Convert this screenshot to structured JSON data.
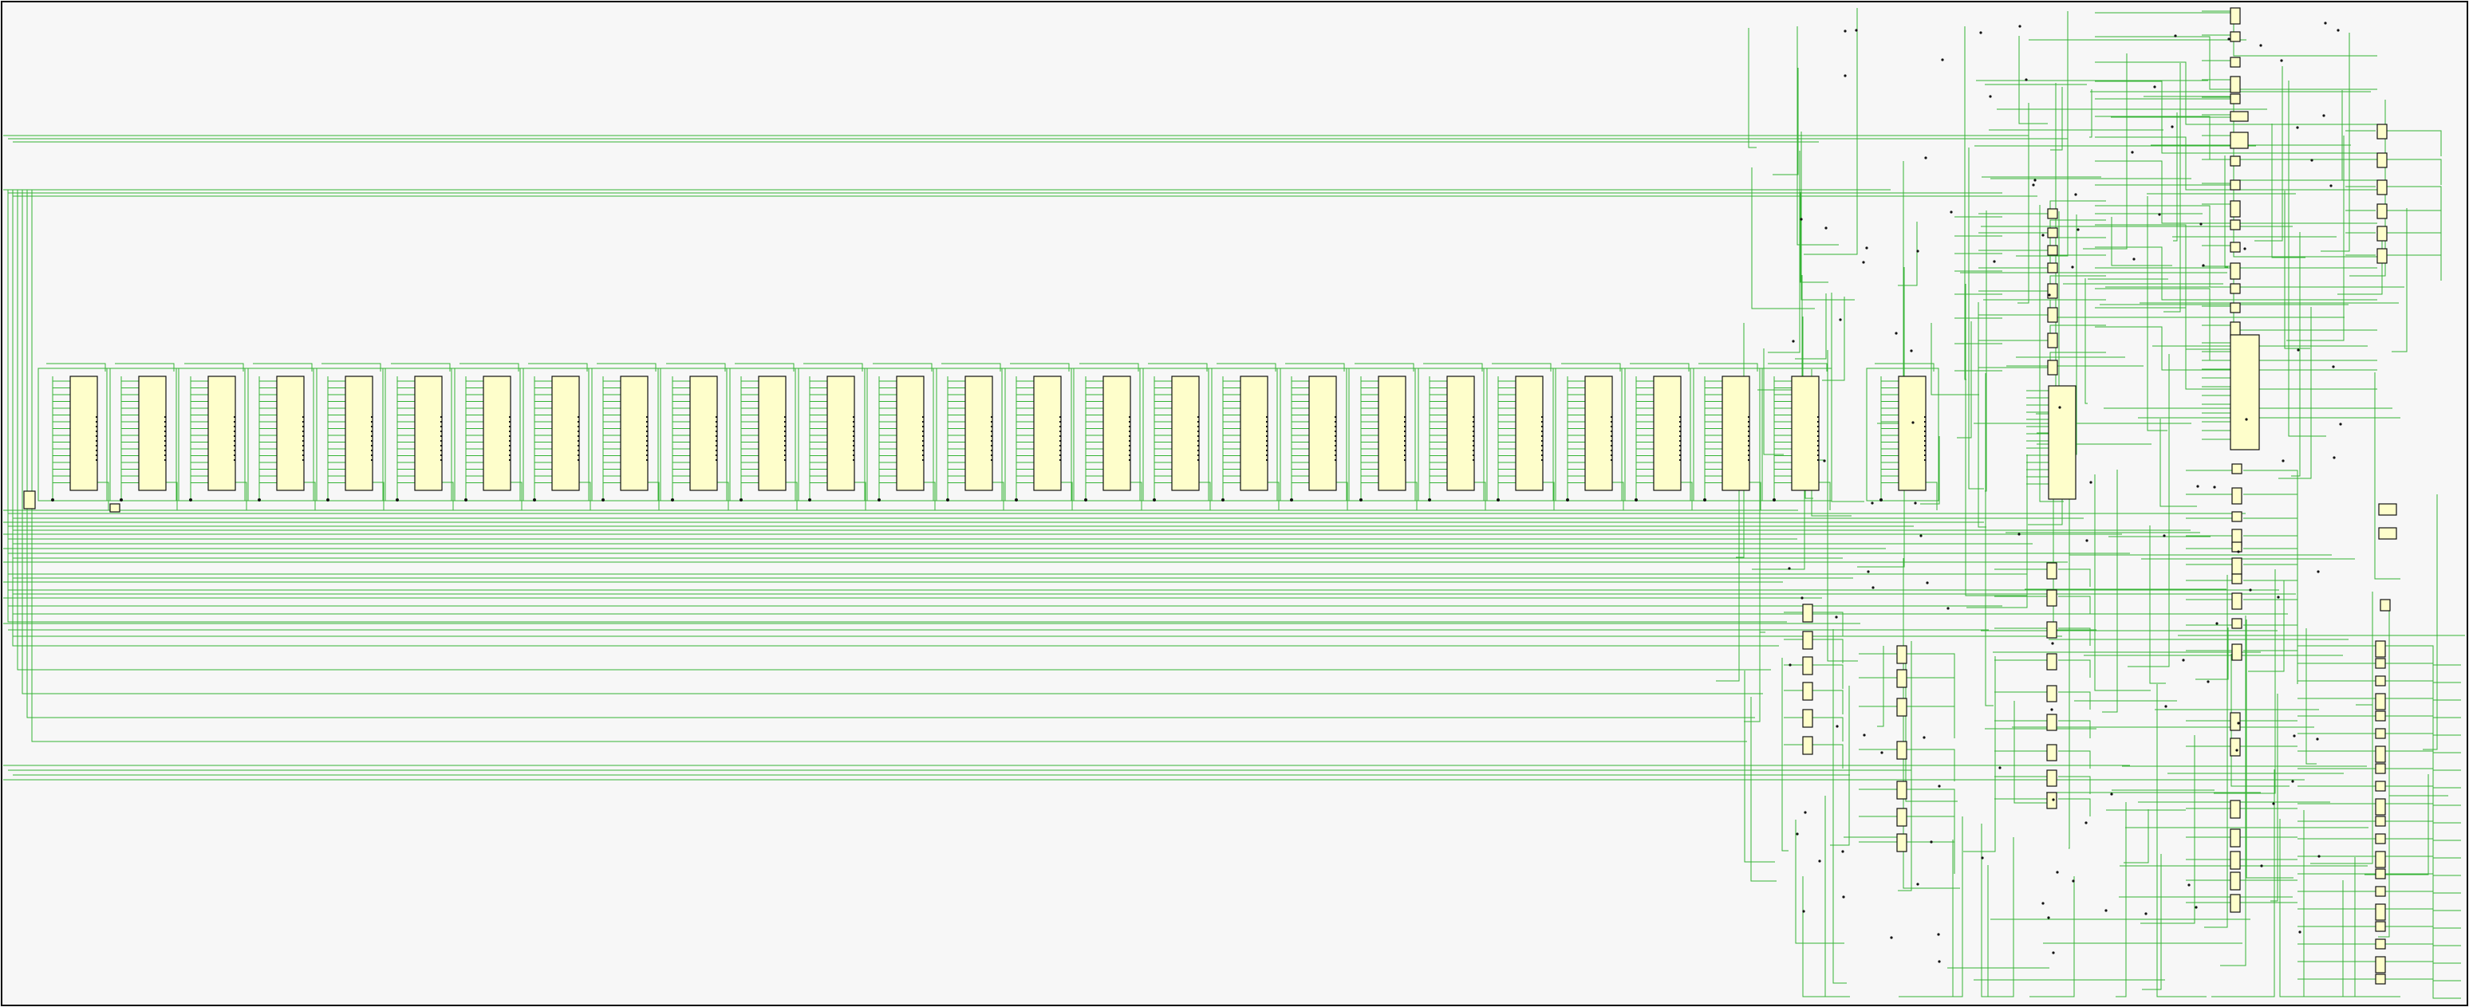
{
  "canvas": {
    "background": "#f7f7f7",
    "border_color": "#111111",
    "wire_color": "#35b335",
    "block_fill": "#fefecb",
    "block_stroke": "#111111"
  },
  "diagram": {
    "type": "schematic-netlist",
    "register_row": {
      "count": 27
    },
    "controller_block": {
      "count": 1
    },
    "small_cells": {
      "column_groups": 7
    }
  }
}
